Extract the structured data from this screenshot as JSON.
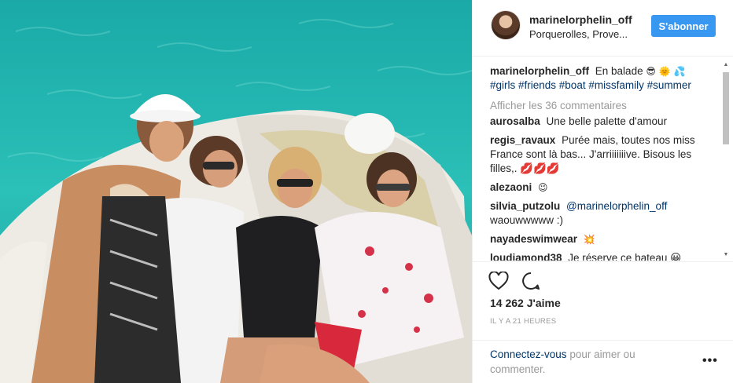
{
  "header": {
    "username": "marinelorphelin_off",
    "location": "Porquerolles, Prove...",
    "follow_label": "S'abonner"
  },
  "caption": {
    "username": "marinelorphelin_off",
    "text": "En balade",
    "emojis": "😎 🌞 💦",
    "hashtags": "#girls #friends #boat #missfamily #summer"
  },
  "show_comments": "Afficher les 36 commentaires",
  "comments": [
    {
      "username": "aurosalba",
      "text": "Une belle palette d'amour"
    },
    {
      "username": "regis_ravaux",
      "text": "Purée mais, toutes nos miss France sont là bas... J'arriiiiiiive. Bisous les filles,. 💋💋💋"
    },
    {
      "username": "alezaoni",
      "text": "😉"
    },
    {
      "username": "silvia_putzolu",
      "mention": "@marinelorphelin_off",
      "text": "waouwwwww :)"
    },
    {
      "username": "nayadeswimwear",
      "text": "💥"
    },
    {
      "username": "loudiamond38",
      "text": "Je réserve ce bateau 😀"
    }
  ],
  "likes": "14 262 J'aime",
  "timestamp": "IL Y A 21 HEURES",
  "login": {
    "link": "Connectez-vous",
    "text": "pour aimer ou commenter."
  },
  "more_label": "•••",
  "icons": {
    "heart": "heart-icon",
    "comment": "comment-icon",
    "more": "more-options-icon"
  },
  "colors": {
    "accent": "#3897f0",
    "link": "#003569",
    "muted": "#999999",
    "sea": "#23b7b1"
  }
}
